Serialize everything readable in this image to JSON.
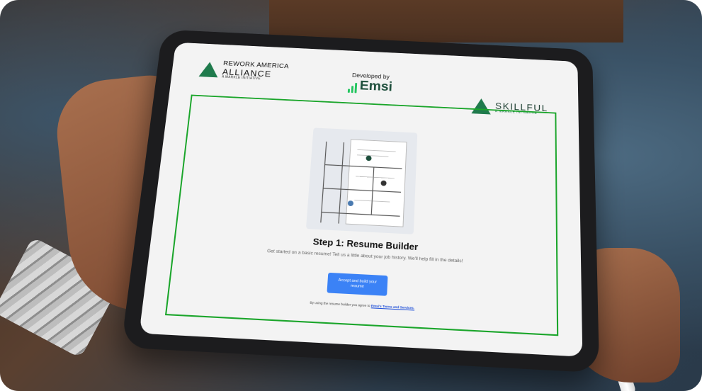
{
  "logos": {
    "rework_line1": "REWORK AMERICA",
    "rework_line2": "ALLIANCE",
    "rework_tagline": "A MARKLE INITIATIVE",
    "developed_by": "Developed by",
    "emsi": "Emsi",
    "skillful": "SKILLFUL",
    "skillful_tagline": "A MARKLE INITIATIVE"
  },
  "content": {
    "step_title": "Step 1: Resume Builder",
    "description": "Get started on a basic resume! Tell us a little about your job history. We'll help fill in the details!",
    "button_label": "Accept and build your resume",
    "terms_prefix": "By using the resume builder you agree to",
    "terms_link": "Emsi's Terms and Services."
  },
  "colors": {
    "accent_green": "#1aa52a",
    "button_blue": "#3b82f6",
    "brand_dark_green": "#1d4e3b"
  }
}
